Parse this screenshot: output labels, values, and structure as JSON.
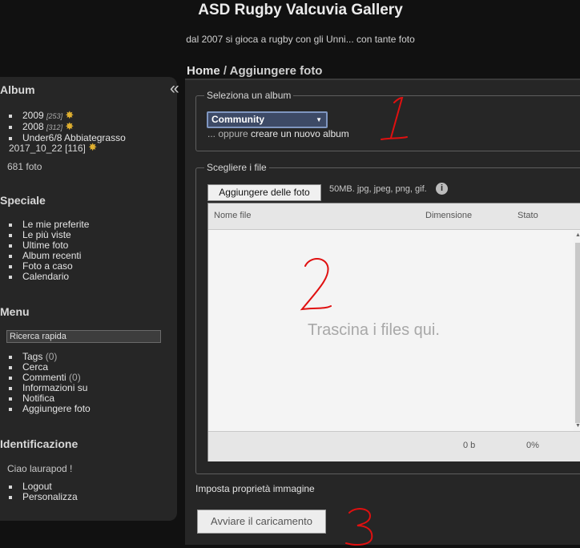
{
  "header": {
    "title": "ASD Rugby Valcuvia Gallery",
    "subtitle": "dal 2007 si gioca a rugby con gli Unni... con tante foto"
  },
  "sidebar": {
    "collapse_icon": "double-chevron-left-icon",
    "album": {
      "heading": "Album",
      "items": [
        {
          "label": "2009",
          "count": "[253]",
          "badge": "new-star-icon"
        },
        {
          "label": "2008",
          "count": "[312]",
          "badge": "new-star-icon"
        },
        {
          "label": "Under6/8 Abbiategrasso"
        }
      ],
      "sub_label": "2017_10_22",
      "sub_count": "[116]",
      "sub_badge": "new-star-icon",
      "total": "681 foto"
    },
    "speciale": {
      "heading": "Speciale",
      "items": [
        "Le mie preferite",
        "Le più viste",
        "Ultime foto",
        "Album recenti",
        "Foto a caso",
        "Calendario"
      ]
    },
    "menu": {
      "heading": "Menu",
      "search_placeholder": "Ricerca rapida",
      "items": [
        {
          "label": "Tags",
          "count": "(0)"
        },
        {
          "label": "Cerca"
        },
        {
          "label": "Commenti",
          "count": "(0)"
        },
        {
          "label": "Informazioni su"
        },
        {
          "label": "Notifica"
        },
        {
          "label": "Aggiungere foto"
        }
      ]
    },
    "identificazione": {
      "heading": "Identificazione",
      "greeting": "Ciao laurapod !",
      "items": [
        "Logout",
        "Personalizza"
      ]
    }
  },
  "main": {
    "breadcrumb": {
      "home": "Home",
      "separator": "/",
      "current": "Aggiungere foto"
    },
    "album_section": {
      "legend": "Seleziona un album",
      "selected_album": "Community",
      "create_prefix": "... oppure",
      "create_link": "creare un nuovo album"
    },
    "files_section": {
      "legend": "Scegliere i file",
      "add_button": "Aggiungere delle foto",
      "limits": "50MB. jpg, jpeg, png, gif.",
      "info_icon": "i",
      "columns": [
        "Nome file",
        "Dimensione",
        "Stato"
      ],
      "drop_text": "Trascina i files qui.",
      "total_size": "0 b",
      "total_percent": "0%"
    },
    "properties_link": "Imposta proprietà immagine",
    "start_button": "Avviare il caricamento"
  },
  "annotations": {
    "color": "#e01010",
    "labels": [
      "1",
      "2",
      "3"
    ]
  },
  "colors": {
    "page_bg": "#111111",
    "panel_bg": "#262626",
    "select_bg": "#3d4a66"
  }
}
